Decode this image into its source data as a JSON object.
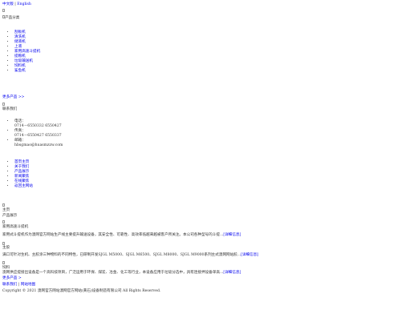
{
  "lang": {
    "zh": "中文版",
    "sep": " | ",
    "en": "English"
  },
  "category": {
    "title": "产品分类",
    "items": [
      "刮板机",
      "清洗机",
      "储液机",
      "上液",
      "家用高速斗提机",
      "提粮机",
      "垃圾输送机",
      "饲料机",
      "鲨鱼机"
    ]
  },
  "more_products": "更多产品 >>",
  "contact": {
    "title": "联系我们",
    "phone_label": "电话：",
    "phone": "0714－6550332 6550427",
    "fax_label": "传真：",
    "fax": "0714－6550427 6550337",
    "email_label": "邮箱：",
    "email": "hbsgmao@huasmzzw.com"
  },
  "nav": [
    "首页主页",
    "关于我们",
    "产品展示",
    "新闻聚焦",
    "在线聚焦",
    "返回主网站"
  ],
  "section_home": "主页",
  "section_products": "产品展示",
  "product1": {
    "title": "家用高速斗提机",
    "desc": "家用式斗提机作为澳网官方网站生产线主要提升输送设备，其安全性、可靠性、高效率低越来越被客户所关注。本公司各种型号的斗提...",
    "link": "[详细信息]"
  },
  "product2": {
    "title": "主胶",
    "desc": "满口可针对生机、主胶涂三种物料的不同特性，已研制开发SJGL M5000、SJGL M6500、SJGL M8000、SJGL M9000系列主式澳网网站胶...",
    "link": "[详细信息]"
  },
  "product3": {
    "title": "饲料",
    "desc": "澳网供应提接出设备是一个高科技项目，广泛运用于环保、煤炭、冶金、化工等行业，本设备应用于垃圾分选中，具有连接拌设备单高...",
    "link": "[详细信息]"
  },
  "more_link": "更多产品 >",
  "bottom_links": {
    "a": "联系我们",
    "sep": " | ",
    "b": "网站地图"
  },
  "copyright": "Copyright © 2021 澳网官方网站澳网官方网站(黄石)设备制造有限公司 All Rights Reserved."
}
